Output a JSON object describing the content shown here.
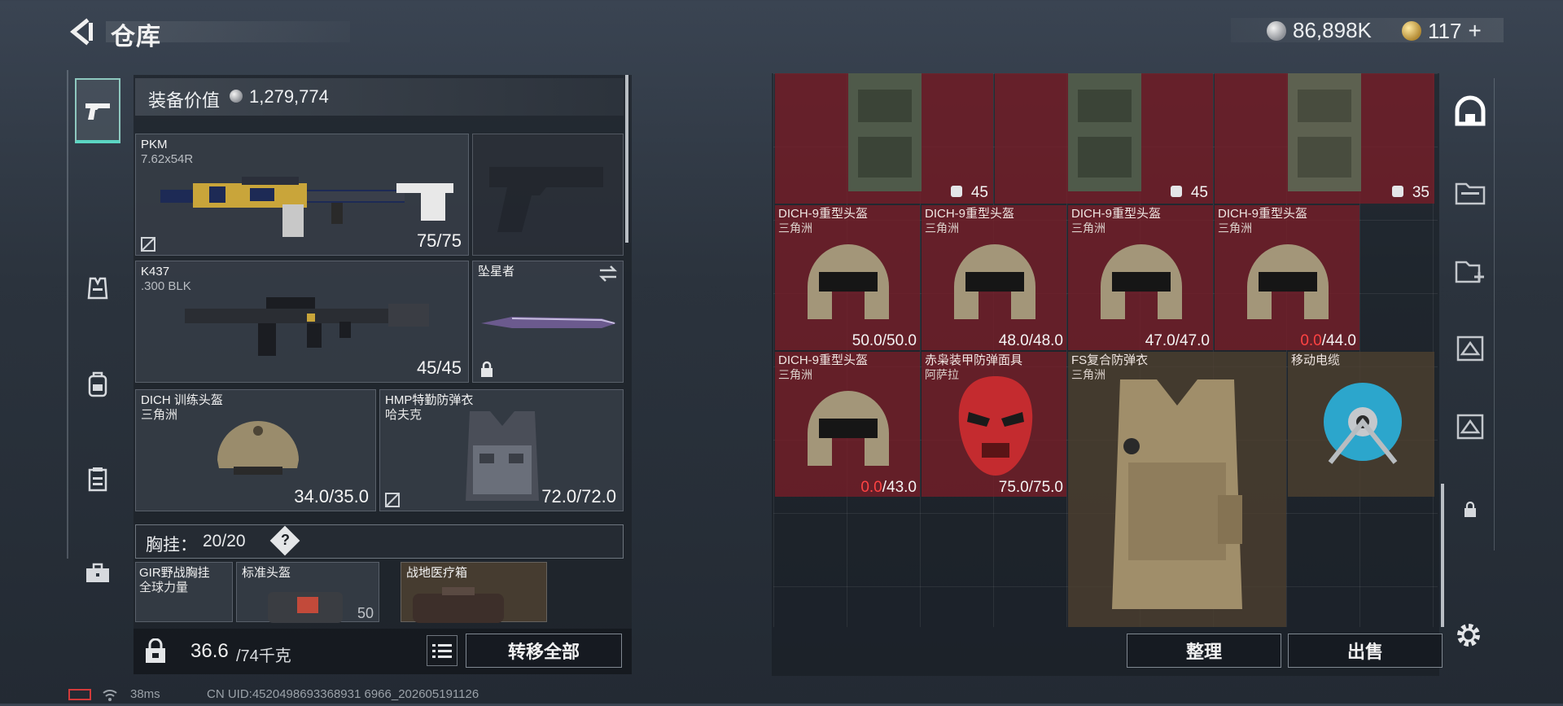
{
  "header": {
    "title": "仓库",
    "currency_silver": "86,898K",
    "currency_gold": "117",
    "gold_plus": "+"
  },
  "equipment": {
    "value_label": "装备价值",
    "value": "1,279,774",
    "primary": {
      "name": "PKM",
      "ammo": "7.62x54R",
      "durability": "75/75"
    },
    "secondary": {
      "name": "K437",
      "ammo": ".300 BLK",
      "durability": "45/45"
    },
    "melee": {
      "name": "坠星者"
    },
    "helmet": {
      "name": "DICH 训练头盔",
      "sub": "三角洲",
      "durability": "34.0/35.0"
    },
    "armor": {
      "name": "HMP特勤防弹衣",
      "sub": "哈夫克",
      "durability": "72.0/72.0"
    },
    "chest_rig": {
      "label": "胸挂：",
      "capacity": "20/20",
      "help": "?"
    },
    "rig_items": [
      {
        "name": "GIR野战胸挂",
        "sub": "全球力量"
      },
      {
        "name": "标准头盔",
        "value": "50"
      },
      {
        "name": "战地医疗箱"
      }
    ],
    "weight": "36.6",
    "weight_max": "/74千克",
    "transfer_all": "转移全部"
  },
  "stash": {
    "bags": [
      {
        "count": "45"
      },
      {
        "count": "45"
      },
      {
        "count": "35"
      }
    ],
    "helmets": [
      {
        "name": "DICH-9重型头盔",
        "sub": "三角洲",
        "cur": "50.0",
        "max": "/50.0",
        "broken": false
      },
      {
        "name": "DICH-9重型头盔",
        "sub": "三角洲",
        "cur": "48.0",
        "max": "/48.0",
        "broken": false
      },
      {
        "name": "DICH-9重型头盔",
        "sub": "三角洲",
        "cur": "47.0",
        "max": "/47.0",
        "broken": false
      },
      {
        "name": "DICH-9重型头盔",
        "sub": "三角洲",
        "cur": "0.0",
        "max": "/44.0",
        "broken": true
      },
      {
        "name": "DICH-9重型头盔",
        "sub": "三角洲",
        "cur": "0.0",
        "max": "/43.0",
        "broken": true
      }
    ],
    "mask": {
      "name": "赤枭装甲防弹面具",
      "sub": "阿萨拉",
      "durability": "75.0/75.0"
    },
    "vest": {
      "name": "FS复合防弹衣",
      "sub": "三角洲"
    },
    "cable": {
      "name": "移动电缆"
    },
    "organize": "整理",
    "sell": "出售"
  },
  "footer": {
    "ping": "38ms",
    "uid": "CN UID:4520498693368931 6966_202605191126"
  },
  "icons": {
    "back": "back-arrow-icon",
    "tabs": [
      "pistol-icon",
      "armor-vest-icon",
      "backpack-icon",
      "chest-rig-icon",
      "toolbox-icon"
    ],
    "stash_tabs": [
      "stash-home-icon",
      "stash-folder-icon",
      "stash-add-icon",
      "stash-tag-icon-1",
      "stash-tag-icon-2",
      "lock-icon"
    ]
  }
}
